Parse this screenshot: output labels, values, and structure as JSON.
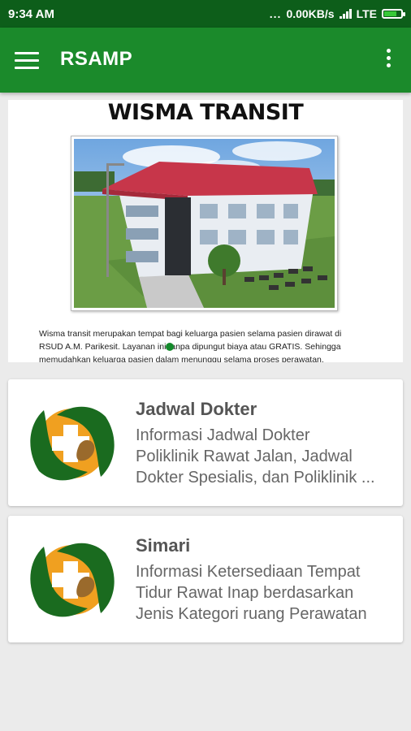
{
  "status_bar": {
    "time": "9:34 AM",
    "dots": "...",
    "speed": "0.00KB/s",
    "network": "LTE",
    "icons": [
      "signal-icon",
      "battery-charging-icon"
    ]
  },
  "app_bar": {
    "title": "RSAMP",
    "icons": [
      "hamburger-menu-icon",
      "overflow-menu-icon"
    ]
  },
  "banner": {
    "heading": "WISMA TRANSIT",
    "line1": "Wisma transit merupakan tempat bagi keluarga pasien selama pasien dirawat di",
    "line2": "RSUD A.M. Parikesit. Layanan ini tanpa dipungut biaya atau GRATIS. Sehingga",
    "line3": "memudahkan keluarga pasien dalam menunggu selama proses perawatan."
  },
  "cards": [
    {
      "title": "Jadwal Dokter",
      "desc_line1": "Informasi Jadwal Dokter",
      "desc_line2": "Poliklinik Rawat Jalan, Jadwal",
      "desc_line3": "Dokter Spesialis, dan Poliklinik ..."
    },
    {
      "title": "Simari",
      "desc_line1": "Informasi Ketersediaan Tempat",
      "desc_line2": "Tidur Rawat Inap berdasarkan",
      "desc_line3": "Jenis Kategori ruang Perawatan"
    }
  ],
  "colors": {
    "status_bar": "#0d5e1a",
    "app_bar": "#1b8a2b",
    "logo_green": "#1a6b1f",
    "logo_orange": "#f0a020",
    "background": "#ebebeb"
  }
}
